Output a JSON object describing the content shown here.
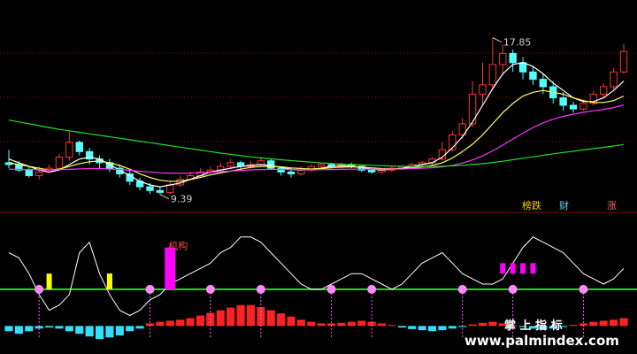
{
  "chart_data": {
    "type": "candlestick",
    "panels": [
      "price",
      "indicator"
    ],
    "price": {
      "ylim": [
        8.8,
        19.5
      ],
      "annotations": {
        "high_label": "17.85",
        "low_label": "9.39"
      },
      "candles": [
        [
          11.1,
          11.0,
          11.8,
          10.8
        ],
        [
          11.0,
          10.7,
          11.2,
          10.6
        ],
        [
          10.7,
          10.4,
          10.9,
          10.3
        ],
        [
          10.4,
          10.6,
          10.9,
          10.2
        ],
        [
          10.6,
          10.8,
          11.0,
          10.5
        ],
        [
          10.8,
          11.4,
          11.6,
          10.7
        ],
        [
          11.4,
          12.2,
          12.8,
          11.2
        ],
        [
          12.2,
          11.7,
          12.3,
          11.5
        ],
        [
          11.7,
          11.3,
          11.9,
          11.0
        ],
        [
          11.3,
          11.1,
          11.5,
          10.8
        ],
        [
          11.1,
          10.8,
          11.3,
          10.6
        ],
        [
          10.8,
          10.5,
          11.0,
          10.3
        ],
        [
          10.5,
          10.1,
          10.7,
          9.9
        ],
        [
          10.1,
          9.8,
          10.3,
          9.6
        ],
        [
          9.8,
          9.6,
          10.0,
          9.4
        ],
        [
          9.6,
          9.5,
          9.8,
          9.39
        ],
        [
          9.5,
          9.9,
          10.1,
          9.4
        ],
        [
          9.9,
          10.2,
          10.4,
          9.8
        ],
        [
          10.2,
          10.4,
          10.6,
          10.1
        ],
        [
          10.4,
          10.6,
          10.8,
          10.3
        ],
        [
          10.6,
          10.7,
          10.9,
          10.5
        ],
        [
          10.7,
          10.9,
          11.1,
          10.6
        ],
        [
          10.9,
          11.1,
          11.3,
          10.8
        ],
        [
          11.1,
          10.9,
          11.2,
          10.7
        ],
        [
          10.9,
          11.0,
          11.2,
          10.8
        ],
        [
          11.0,
          11.2,
          11.4,
          10.9
        ],
        [
          11.2,
          10.8,
          11.3,
          10.7
        ],
        [
          10.8,
          10.6,
          10.9,
          10.4
        ],
        [
          10.6,
          10.5,
          10.8,
          10.3
        ],
        [
          10.5,
          10.7,
          10.9,
          10.4
        ],
        [
          10.7,
          10.9,
          11.0,
          10.6
        ],
        [
          10.9,
          11.0,
          11.1,
          10.8
        ],
        [
          11.0,
          10.9,
          11.1,
          10.8
        ],
        [
          10.9,
          11.0,
          11.1,
          10.8
        ],
        [
          11.0,
          10.9,
          11.1,
          10.8
        ],
        [
          10.9,
          10.7,
          11.0,
          10.6
        ],
        [
          10.7,
          10.6,
          10.8,
          10.5
        ],
        [
          10.6,
          10.7,
          10.8,
          10.5
        ],
        [
          10.7,
          10.8,
          10.9,
          10.6
        ],
        [
          10.8,
          10.9,
          11.0,
          10.7
        ],
        [
          10.9,
          11.0,
          11.1,
          10.8
        ],
        [
          11.0,
          11.1,
          11.2,
          10.9
        ],
        [
          11.1,
          11.3,
          11.4,
          11.0
        ],
        [
          11.3,
          11.8,
          12.2,
          11.2
        ],
        [
          11.8,
          12.6,
          12.8,
          11.7
        ],
        [
          12.6,
          13.2,
          13.5,
          12.4
        ],
        [
          13.2,
          14.8,
          15.5,
          13.0
        ],
        [
          14.8,
          15.3,
          16.5,
          14.2
        ],
        [
          15.3,
          16.4,
          17.85,
          15.0
        ],
        [
          16.4,
          17.0,
          17.5,
          15.8
        ],
        [
          17.0,
          16.5,
          17.2,
          16.0
        ],
        [
          16.5,
          16.0,
          16.8,
          15.6
        ],
        [
          16.0,
          15.6,
          16.3,
          15.3
        ],
        [
          15.6,
          15.2,
          15.9,
          14.8
        ],
        [
          15.2,
          14.6,
          15.5,
          14.3
        ],
        [
          14.6,
          14.2,
          14.9,
          13.9
        ],
        [
          14.2,
          14.0,
          14.4,
          13.8
        ],
        [
          14.0,
          14.3,
          14.5,
          13.9
        ],
        [
          14.3,
          14.8,
          15.0,
          14.2
        ],
        [
          14.8,
          15.2,
          15.4,
          14.6
        ],
        [
          15.2,
          16.0,
          16.2,
          15.0
        ],
        [
          16.0,
          17.1,
          17.5,
          15.9
        ]
      ],
      "ma_lines": [
        {
          "color": "#ffffff",
          "values": [
            11.3,
            11.1,
            10.9,
            10.7,
            10.6,
            10.7,
            11.0,
            11.3,
            11.4,
            11.3,
            11.0,
            10.7,
            10.4,
            10.1,
            9.9,
            9.8,
            9.9,
            10.0,
            10.2,
            10.4,
            10.6,
            10.7,
            10.8,
            10.9,
            10.95,
            11.0,
            10.95,
            10.85,
            10.75,
            10.7,
            10.75,
            10.8,
            10.9,
            10.95,
            10.9,
            10.85,
            10.75,
            10.7,
            10.75,
            10.8,
            10.9,
            11.0,
            11.1,
            11.4,
            11.9,
            12.5,
            13.3,
            14.2,
            15.1,
            15.9,
            16.4,
            16.5,
            16.3,
            15.9,
            15.4,
            15.0,
            14.6,
            14.4,
            14.4,
            14.6,
            15.0,
            15.5
          ]
        },
        {
          "color": "#ffff66",
          "values": [
            11.1,
            11.0,
            10.9,
            10.8,
            10.7,
            10.75,
            10.9,
            11.05,
            11.15,
            11.2,
            11.1,
            10.95,
            10.75,
            10.5,
            10.3,
            10.15,
            10.1,
            10.1,
            10.2,
            10.3,
            10.45,
            10.55,
            10.65,
            10.75,
            10.85,
            10.9,
            10.9,
            10.88,
            10.82,
            10.78,
            10.76,
            10.78,
            10.82,
            10.86,
            10.88,
            10.86,
            10.82,
            10.78,
            10.76,
            10.78,
            10.82,
            10.88,
            10.96,
            11.1,
            11.35,
            11.7,
            12.1,
            12.6,
            13.2,
            13.8,
            14.3,
            14.7,
            14.9,
            15.0,
            14.9,
            14.8,
            14.6,
            14.45,
            14.35,
            14.35,
            14.45,
            14.7
          ]
        },
        {
          "color": "#ff33ff",
          "values": [
            10.75,
            10.74,
            10.73,
            10.72,
            10.71,
            10.72,
            10.74,
            10.77,
            10.78,
            10.78,
            10.76,
            10.73,
            10.69,
            10.64,
            10.6,
            10.56,
            10.54,
            10.53,
            10.54,
            10.56,
            10.59,
            10.62,
            10.65,
            10.68,
            10.71,
            10.73,
            10.74,
            10.74,
            10.73,
            10.72,
            10.72,
            10.72,
            10.73,
            10.74,
            10.75,
            10.75,
            10.75,
            10.75,
            10.75,
            10.76,
            10.78,
            10.8,
            10.83,
            10.88,
            10.96,
            11.08,
            11.25,
            11.47,
            11.74,
            12.05,
            12.38,
            12.7,
            13.0,
            13.25,
            13.45,
            13.6,
            13.72,
            13.82,
            13.9,
            13.98,
            14.08,
            14.22
          ]
        },
        {
          "color": "#22dd22",
          "values": [
            13.4,
            13.3,
            13.2,
            13.1,
            13.0,
            12.9,
            12.82,
            12.74,
            12.66,
            12.58,
            12.5,
            12.42,
            12.34,
            12.26,
            12.18,
            12.1,
            12.02,
            11.94,
            11.86,
            11.78,
            11.7,
            11.62,
            11.55,
            11.48,
            11.42,
            11.36,
            11.31,
            11.26,
            11.21,
            11.17,
            11.13,
            11.09,
            11.06,
            11.03,
            11.0,
            10.98,
            10.96,
            10.94,
            10.92,
            10.91,
            10.9,
            10.9,
            10.9,
            10.91,
            10.93,
            10.96,
            11.0,
            11.05,
            11.11,
            11.18,
            11.26,
            11.34,
            11.42,
            11.5,
            11.58,
            11.65,
            11.72,
            11.79,
            11.86,
            11.93,
            12.0,
            12.08
          ]
        }
      ]
    },
    "indicator": {
      "ylim": [
        -4,
        20
      ],
      "white_line": [
        14,
        13,
        10,
        6,
        3,
        4,
        6,
        14,
        16,
        10,
        6,
        3,
        2,
        3,
        5,
        6,
        8,
        9,
        10,
        11,
        12,
        14,
        15,
        17,
        17,
        16,
        14,
        12,
        10,
        8,
        7,
        7,
        8,
        9,
        10,
        10,
        9,
        8,
        7,
        8,
        10,
        12,
        13,
        14,
        12,
        10,
        9,
        8,
        8,
        9,
        12,
        15,
        17,
        16,
        15,
        14,
        12,
        10,
        9,
        8,
        9,
        11
      ],
      "red_line": [
        null,
        null,
        null,
        null,
        null,
        null,
        null,
        null,
        null,
        null,
        null,
        null,
        null,
        null,
        null,
        null,
        null,
        null,
        null,
        null,
        null,
        null,
        null,
        null,
        null,
        null,
        null,
        null,
        null,
        null,
        null,
        null,
        null,
        null,
        null,
        null,
        null,
        null,
        null,
        null,
        null,
        null,
        null,
        null,
        null,
        null,
        null,
        null,
        null,
        null,
        null,
        null,
        null,
        null,
        null,
        null,
        null,
        null,
        null,
        null,
        null,
        null
      ],
      "green_line_level": 7,
      "yellow_bars": [
        4,
        10,
        10
      ],
      "magenta_bars": [
        [
          49,
          12,
          10
        ],
        [
          50,
          12,
          10
        ],
        [
          51,
          12,
          10
        ],
        [
          52,
          12,
          10
        ]
      ],
      "event_markers": [
        3,
        14,
        20,
        25,
        32,
        36,
        45,
        50,
        57,
        63
      ],
      "histogram": [
        -1,
        -1.5,
        -1,
        -0.5,
        -0.3,
        -0.5,
        -1,
        -1.5,
        -2,
        -2.5,
        -2.2,
        -1.8,
        -1,
        -0.5,
        0.5,
        0.8,
        1,
        1.2,
        1.5,
        2,
        2.5,
        3,
        3.5,
        4,
        4,
        3.6,
        3,
        2.4,
        1.8,
        1.2,
        0.8,
        0.5,
        0.5,
        0.6,
        0.8,
        1,
        0.8,
        0.5,
        0.2,
        -0.3,
        -0.6,
        -0.8,
        -1,
        -0.8,
        -0.5,
        -0.2,
        0.3,
        0.6,
        0.8,
        0.5,
        0.2,
        -0.2,
        -0.5,
        -0.7,
        -0.5,
        -0.2,
        0.2,
        0.5,
        0.8,
        1,
        1.2,
        1.5
      ],
      "buy_label": "机构",
      "tags": [
        "榜跌",
        "财",
        "涨"
      ]
    },
    "colors": {
      "up": "#ff3333",
      "down": "#54ffff",
      "separator": "#8b0000",
      "grid": "#990000"
    }
  },
  "watermark": {
    "cn": "掌 上 指 标",
    "url": "www.palmindex.com"
  }
}
